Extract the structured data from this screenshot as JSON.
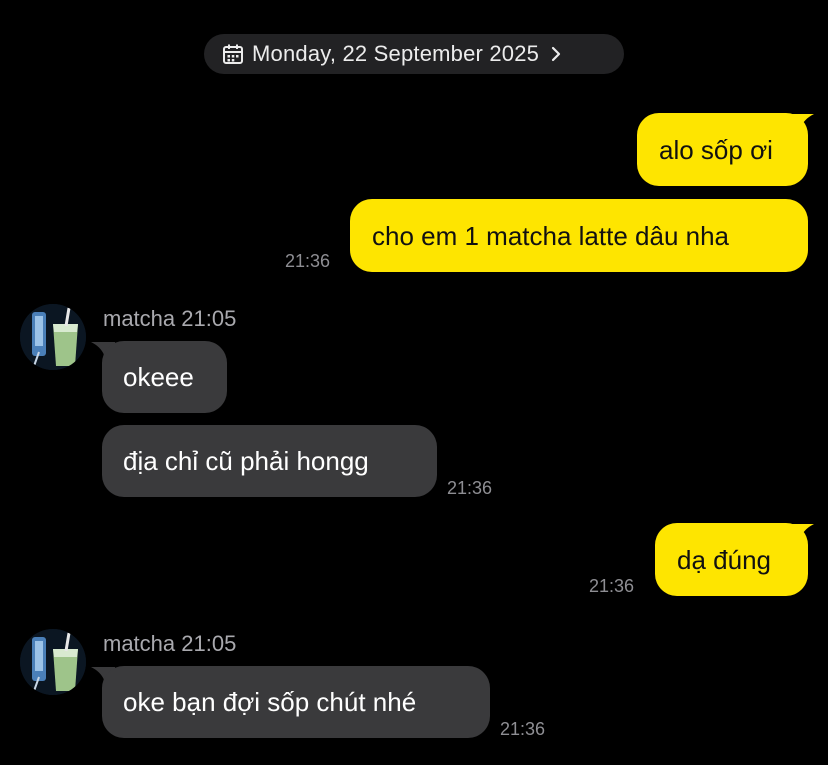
{
  "header": {
    "date_label": "Monday, 22 September 2025",
    "calendar_icon": "calendar-icon",
    "chevron_icon": "chevron-right-icon"
  },
  "colors": {
    "background": "#000000",
    "outgoing_bubble": "#fee500",
    "incoming_bubble": "#3a3a3c",
    "timestamp": "#8e8e93"
  },
  "messages": [
    {
      "direction": "outgoing",
      "text": "alo sốp ơi"
    },
    {
      "direction": "outgoing",
      "text": "cho em 1 matcha latte dâu nha",
      "time": "21:36"
    },
    {
      "direction": "incoming",
      "sender": "matcha 21:05",
      "text": "okeee"
    },
    {
      "direction": "incoming",
      "text": "địa chỉ cũ phải hongg",
      "time": "21:36"
    },
    {
      "direction": "outgoing",
      "text": "dạ đúng",
      "time": "21:36"
    },
    {
      "direction": "incoming",
      "sender": "matcha 21:05",
      "text": "oke bạn đợi sốp chút nhé",
      "time": "21:36"
    }
  ]
}
